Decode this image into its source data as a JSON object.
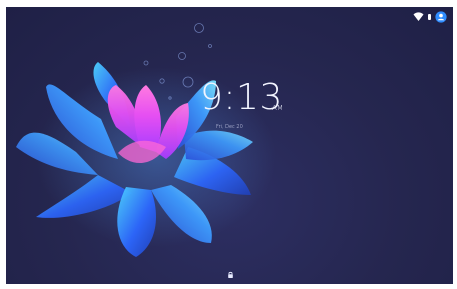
{
  "status_bar": {
    "icons": [
      "wifi-icon",
      "battery-icon",
      "account-icon"
    ],
    "accent": "#2f8cff"
  },
  "clock": {
    "time": "9:13",
    "ampm": "AM",
    "date": "Fri, Dec 20"
  },
  "bottom": {
    "icon": "lock-icon"
  },
  "wallpaper": {
    "description": "blue lotus flower",
    "background_color": "#25264f",
    "petal_colors": [
      "#2e6cff",
      "#3aa2ff",
      "#c046ff",
      "#ff5bd1"
    ]
  }
}
